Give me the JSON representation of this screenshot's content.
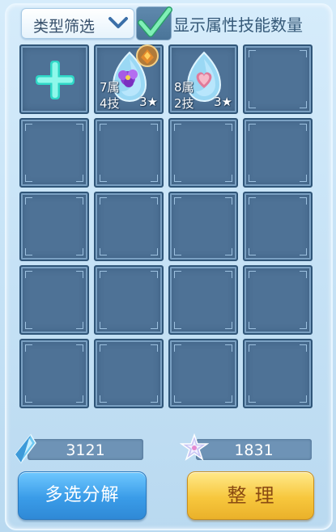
{
  "toolbar": {
    "filter_label": "类型筛选",
    "show_stats_label": "显示属性技能数量",
    "show_stats_checked": true
  },
  "inventory": {
    "add_slot_icon": "plus-icon",
    "items": [
      {
        "attr_line": "7属",
        "skill_line": "4技",
        "stars": "3★",
        "icon": "blue-pet-egg-with-purple-flower-and-golden-badge-icon"
      },
      {
        "attr_line": "8属",
        "skill_line": "2技",
        "stars": "3★",
        "icon": "blue-pet-egg-with-pink-heart-icon"
      }
    ],
    "rows": 5,
    "columns": 4
  },
  "currencies": {
    "crystal": {
      "icon": "blue-crystal-icon",
      "value": "3121"
    },
    "star": {
      "icon": "star-gem-icon",
      "value": "1831"
    }
  },
  "buttons": {
    "decompose_label": "多选分解",
    "sort_label": "整理"
  },
  "colors": {
    "cell_fill": "#4e7296",
    "check_green": "#6fe0a6",
    "decompose_button": "#3a9ce8",
    "sort_button": "#f7c73d",
    "sort_text": "#8a4a12"
  }
}
